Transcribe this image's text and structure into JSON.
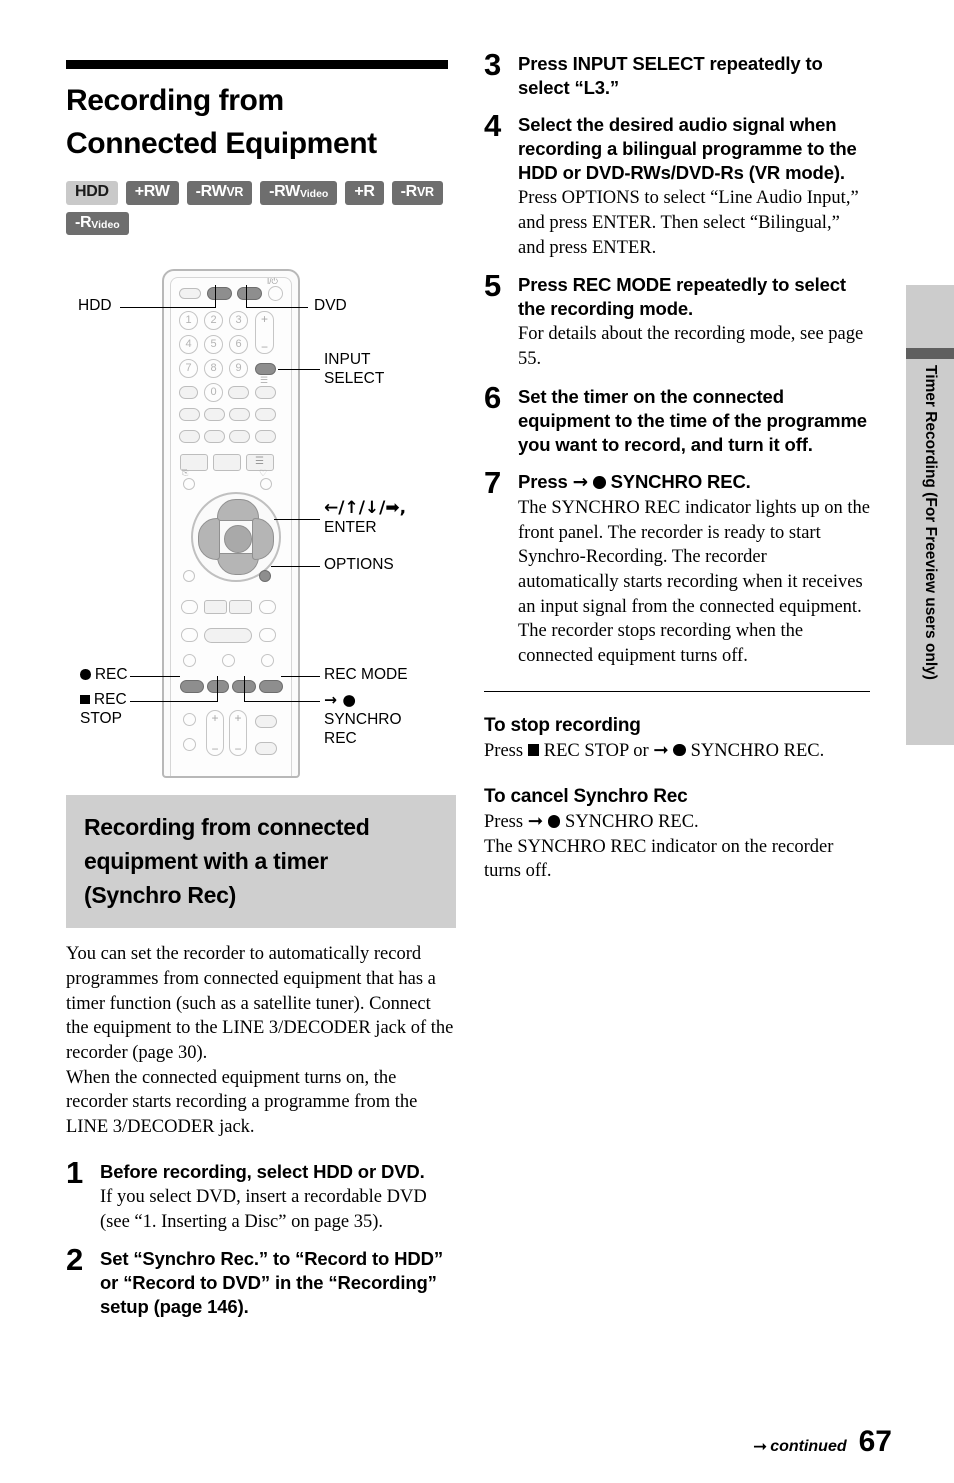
{
  "page": {
    "number": "67",
    "continued_label": "continued",
    "continued_icon": "right-arrow-icon"
  },
  "side_tab": {
    "label": "Timer Recording (For Freeview users only)",
    "bg_color": "#cccccc",
    "rule_color": "#5f5f5f"
  },
  "title": {
    "line1": "Recording from",
    "line2": "Connected Equipment"
  },
  "media_badges": [
    {
      "text": "HDD",
      "style": "light"
    },
    {
      "text": "+RW",
      "style": "dark"
    },
    {
      "text": "-RW",
      "sub": "VR",
      "sub_size": "small-caps",
      "style": "dark"
    },
    {
      "text": "-RW",
      "sub": "Video",
      "style": "dark"
    },
    {
      "text": "+R",
      "style": "dark"
    },
    {
      "text": "-R",
      "sub": "VR",
      "sub_size": "small-caps",
      "style": "dark"
    },
    {
      "text": "-R",
      "sub": "Video",
      "style": "dark"
    }
  ],
  "remote_figure": {
    "labels": {
      "hdd": "HDD",
      "dvd": "DVD",
      "input_select_l1": "INPUT",
      "input_select_l2": "SELECT",
      "arrows_enter_l1": "←/↑/↓/➡,",
      "arrows_enter_l2": "ENTER",
      "options": "OPTIONS",
      "rec_mode": "REC MODE",
      "synchro_l1": "→ ●",
      "synchro_l2": "SYNCHRO",
      "synchro_l3": "REC",
      "rec": "REC",
      "rec_stop_l1": "REC",
      "rec_stop_l2": "STOP"
    },
    "numeric_keys": [
      "1",
      "2",
      "3",
      "4",
      "5",
      "6",
      "7",
      "8",
      "9",
      "0"
    ]
  },
  "subhead": {
    "line1": "Recording from connected",
    "line2": "equipment with a timer",
    "line3": "(Synchro Rec)"
  },
  "intro": {
    "p1": "You can set the recorder to automatically record programmes from connected equipment that has a timer function (such as a satellite tuner). Connect the equipment to the LINE 3/DECODER jack of the recorder (page 30).",
    "p2": "When the connected equipment turns on, the recorder starts recording a programme from the LINE 3/DECODER jack."
  },
  "steps_left": [
    {
      "num": "1",
      "head": "Before recording, select HDD or DVD.",
      "sub": "If you select DVD, insert a recordable DVD (see “1. Inserting a Disc” on page 35)."
    },
    {
      "num": "2",
      "head": "Set “Synchro Rec.” to “Record to HDD” or “Record to DVD” in the “Recording” setup (page 146).",
      "sub": ""
    }
  ],
  "steps_right": [
    {
      "num": "3",
      "head": "Press INPUT SELECT repeatedly to select “L3.”",
      "sub": ""
    },
    {
      "num": "4",
      "head": "Select the desired audio signal when recording a bilingual programme to the HDD or DVD-RWs/DVD-Rs (VR mode).",
      "sub": "Press OPTIONS to select “Line Audio Input,” and press ENTER. Then select “Bilingual,” and press ENTER."
    },
    {
      "num": "5",
      "head": "Press REC MODE repeatedly to select the recording mode.",
      "sub": "For details about the recording mode, see page 55."
    },
    {
      "num": "6",
      "head": "Set the timer on the connected equipment to the time of the programme you want to record, and turn it off.",
      "sub": ""
    },
    {
      "num": "7",
      "head_prefix": "Press",
      "head_arrow": "→",
      "head_circle": "circle-record-icon",
      "head_suffix": "SYNCHRO REC.",
      "sub": "The SYNCHRO REC indicator lights up on the front panel. The recorder is ready to start Synchro-Recording. The recorder automatically starts recording when it receives an input signal from the connected equipment. The recorder stops recording when the connected equipment turns off."
    }
  ],
  "stop_recording": {
    "heading": "To stop recording",
    "press_word": "Press",
    "rec_stop_text": "REC STOP",
    "or_word": "or",
    "synchro_text": "SYNCHRO REC."
  },
  "cancel_synchro": {
    "heading": "To cancel Synchro Rec",
    "press_word": "Press",
    "synchro_text": "SYNCHRO REC.",
    "line2": "The SYNCHRO REC indicator on the recorder turns off."
  }
}
